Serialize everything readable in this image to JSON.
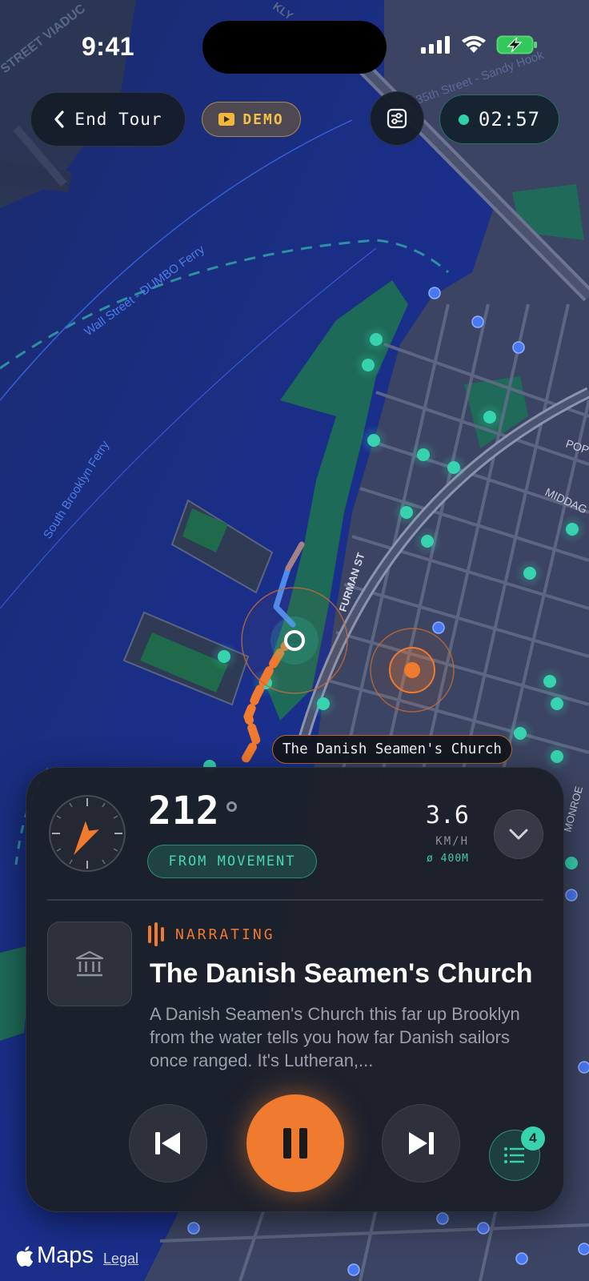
{
  "status_bar": {
    "time": "9:41"
  },
  "top_bar": {
    "end_tour_label": "End Tour",
    "demo_label": "DEMO",
    "timer": "02:57"
  },
  "map": {
    "labels": {
      "ferry1": "Wall Street - DUMBO Ferry",
      "ferry2": "South Brooklyn Ferry",
      "street_furman": "FURMAN ST",
      "street_35th": "35th Street - Sandy Hook",
      "street_viaduct": "STREET VIADUC",
      "street_middag": "MIDDAG",
      "street_pop": "POP",
      "street_monroe": "MONROE",
      "street_kly": "KLY"
    },
    "poi_label": "The Danish Seamen's Church"
  },
  "card": {
    "heading_value": "212",
    "heading_source": "FROM MOVEMENT",
    "speed_value": "3.6",
    "speed_unit": "KM/H",
    "radius": "ø 400M",
    "status": "NARRATING",
    "poi_title": "The Danish Seamen's Church",
    "poi_description": "A Danish Seamen's Church this far up Brooklyn from the water tells you how far Danish sailors once ranged. It's Lutheran,...",
    "queue_count": "4"
  },
  "footer": {
    "maps_brand": "Maps",
    "legal_label": "Legal"
  },
  "colors": {
    "accent": "#f07a2e",
    "teal": "#37d3ae",
    "water": "#1a2d8a",
    "land": "#3f4863",
    "park": "#1a6d5a"
  }
}
